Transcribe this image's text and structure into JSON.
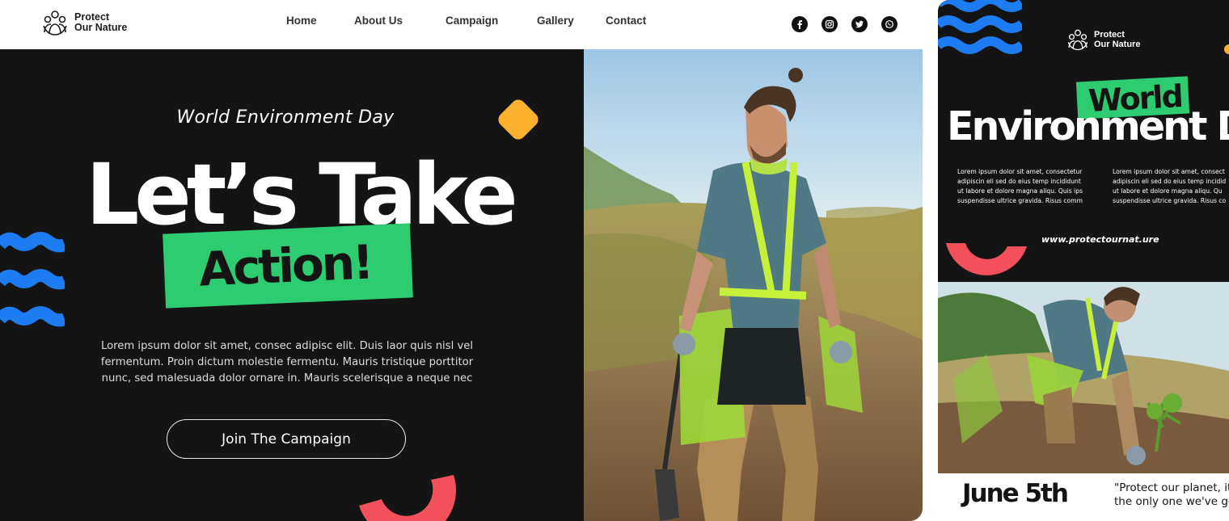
{
  "brand": {
    "line1": "Protect",
    "line2": "Our Nature"
  },
  "nav": {
    "home": "Home",
    "about": "About Us",
    "campaign": "Campaign",
    "gallery": "Gallery",
    "contact": "Contact"
  },
  "socials": [
    "facebook-icon",
    "instagram-icon",
    "twitter-icon",
    "whatsapp-icon"
  ],
  "hero": {
    "kicker": "World Environment Day",
    "headline": "Let’s Take",
    "highlight": "Action!",
    "body_line1": "Lorem ipsum dolor sit amet, consec adipisc elit. Duis laor quis nisl vel",
    "body_line2": "fermentum. Proin dictum molestie fermentu. Mauris tristique porttitor",
    "body_line3": "nunc, sed malesuada dolor ornare in. Mauris scelerisque a neque nec",
    "cta": "Join The Campaign"
  },
  "poster": {
    "brand_line1": "Protect",
    "brand_line2": "Our Nature",
    "world": "World",
    "environment": "Environment Da",
    "col1_l1": "Lorem ipsum dolor sit amet, consectetur",
    "col1_l2": "adipiscin eli sed do eius temp incididunt",
    "col1_l3": "ut labore et dolore magna aliqu. Quis ips",
    "col1_l4": "suspendisse ultrice gravida. Risus comm",
    "col2_l1": "Lorem ipsum dolor sit amet, consect",
    "col2_l2": "adipiscin eli sed do eius temp incidid",
    "col2_l3": "ut labore et dolore magna aliqu. Qu",
    "col2_l4": "suspendisse ultrice gravida. Risus co",
    "url": "www.protectournat.ure",
    "date": "June 5th",
    "quote_l1": "\"Protect our planet, it",
    "quote_l2": "the only one we've go"
  },
  "colors": {
    "dark": "#141414",
    "green": "#2ecc71",
    "blue": "#1e7cf2",
    "orange": "#fbb02f",
    "coral": "#f2505a"
  }
}
